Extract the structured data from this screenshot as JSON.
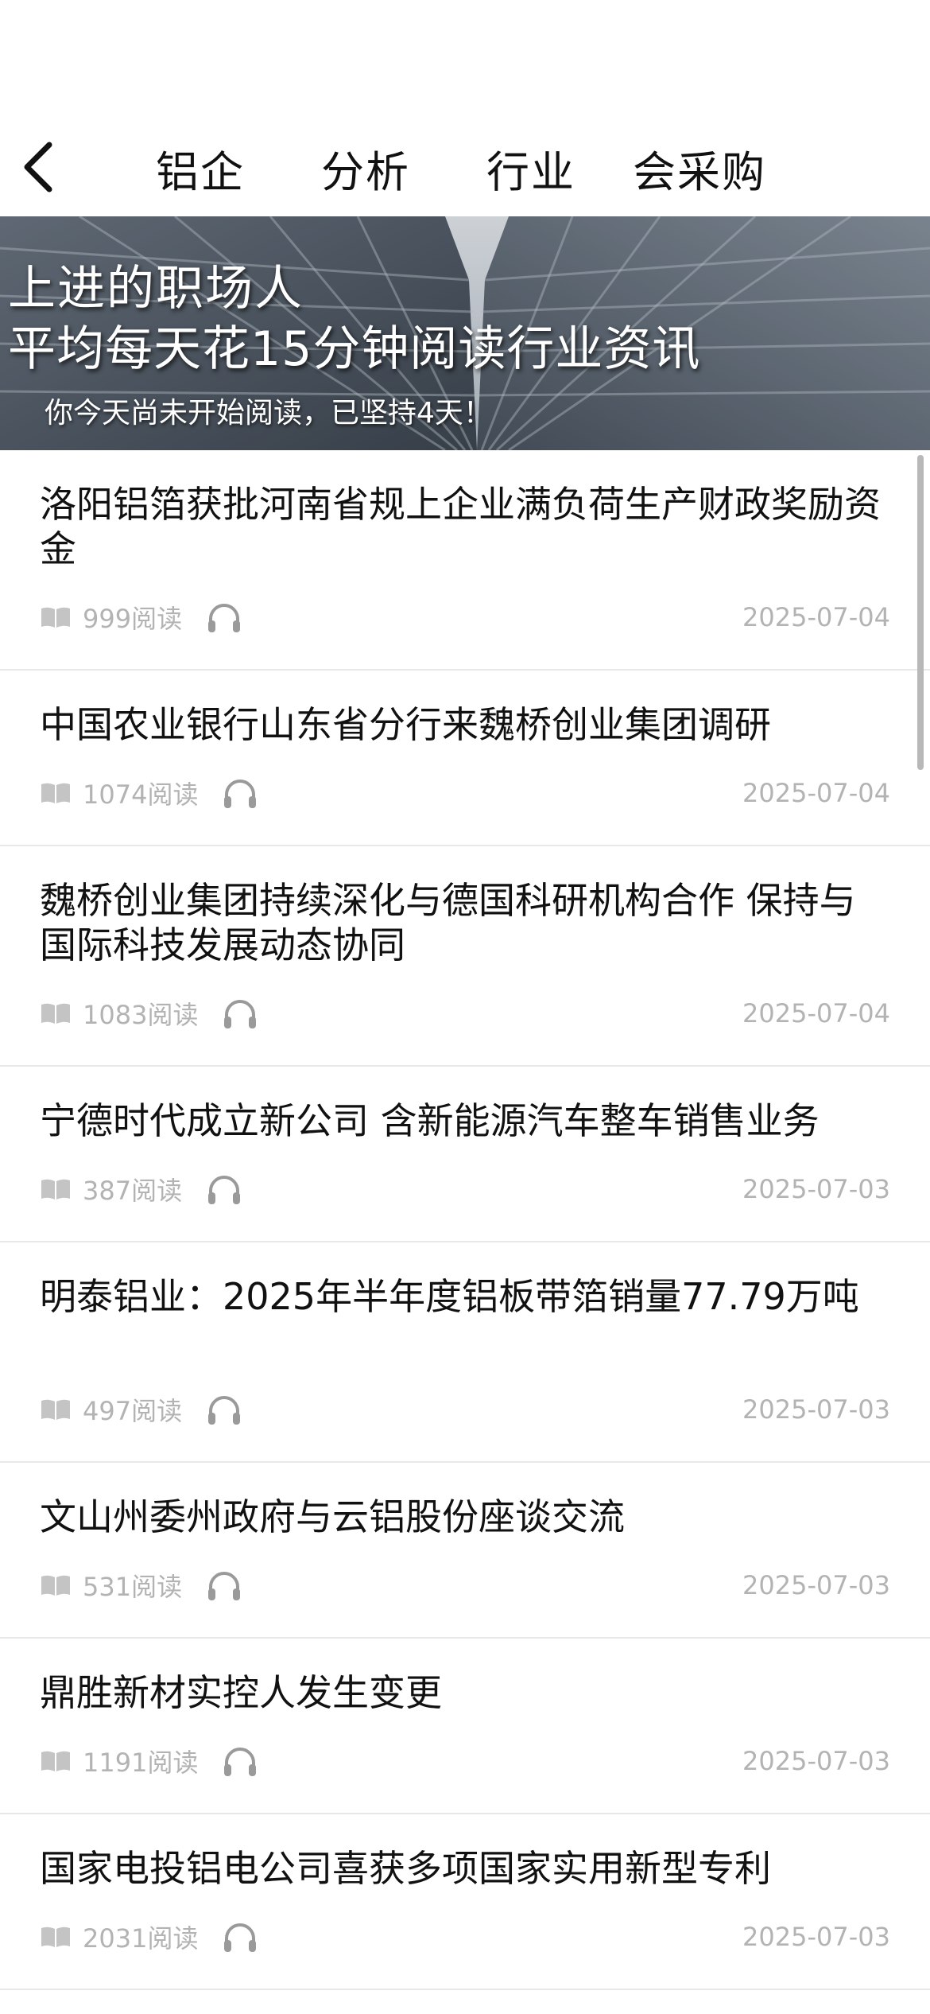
{
  "nav": {
    "tabs": [
      "铝企",
      "分析",
      "行业",
      "会采购"
    ]
  },
  "banner": {
    "line1": "上进的职场人",
    "line2": "平均每天花15分钟阅读行业资讯",
    "line3": "你今天尚未开始阅读，已坚持4天！"
  },
  "articles": [
    {
      "title": "洛阳铝箔获批河南省规上企业满负荷生产财政奖励资金",
      "reads": "999阅读",
      "date": "2025-07-04"
    },
    {
      "title": "中国农业银行山东省分行来魏桥创业集团调研",
      "reads": "1074阅读",
      "date": "2025-07-04"
    },
    {
      "title": "魏桥创业集团持续深化与德国科研机构合作 保持与国际科技发展动态协同",
      "reads": "1083阅读",
      "date": "2025-07-04"
    },
    {
      "title": "宁德时代成立新公司 含新能源汽车整车销售业务",
      "reads": "387阅读",
      "date": "2025-07-03"
    },
    {
      "title": "明泰铝业：2025年半年度铝板带箔销量77.79万吨",
      "reads": "497阅读",
      "date": "2025-07-03"
    },
    {
      "title": "文山州委州政府与云铝股份座谈交流",
      "reads": "531阅读",
      "date": "2025-07-03"
    },
    {
      "title": "鼎胜新材实控人发生变更",
      "reads": "1191阅读",
      "date": "2025-07-03"
    },
    {
      "title": "国家电投铝电公司喜获多项国家实用新型专利",
      "reads": "2031阅读",
      "date": "2025-07-03"
    }
  ],
  "icons": {
    "back": "chevron-left-icon",
    "reads": "book-icon",
    "audio": "headphones-icon"
  },
  "colors": {
    "text": "#111111",
    "meta": "#b3b3b3",
    "divider": "#e8e8e8",
    "icon": "#9a9a9a"
  }
}
